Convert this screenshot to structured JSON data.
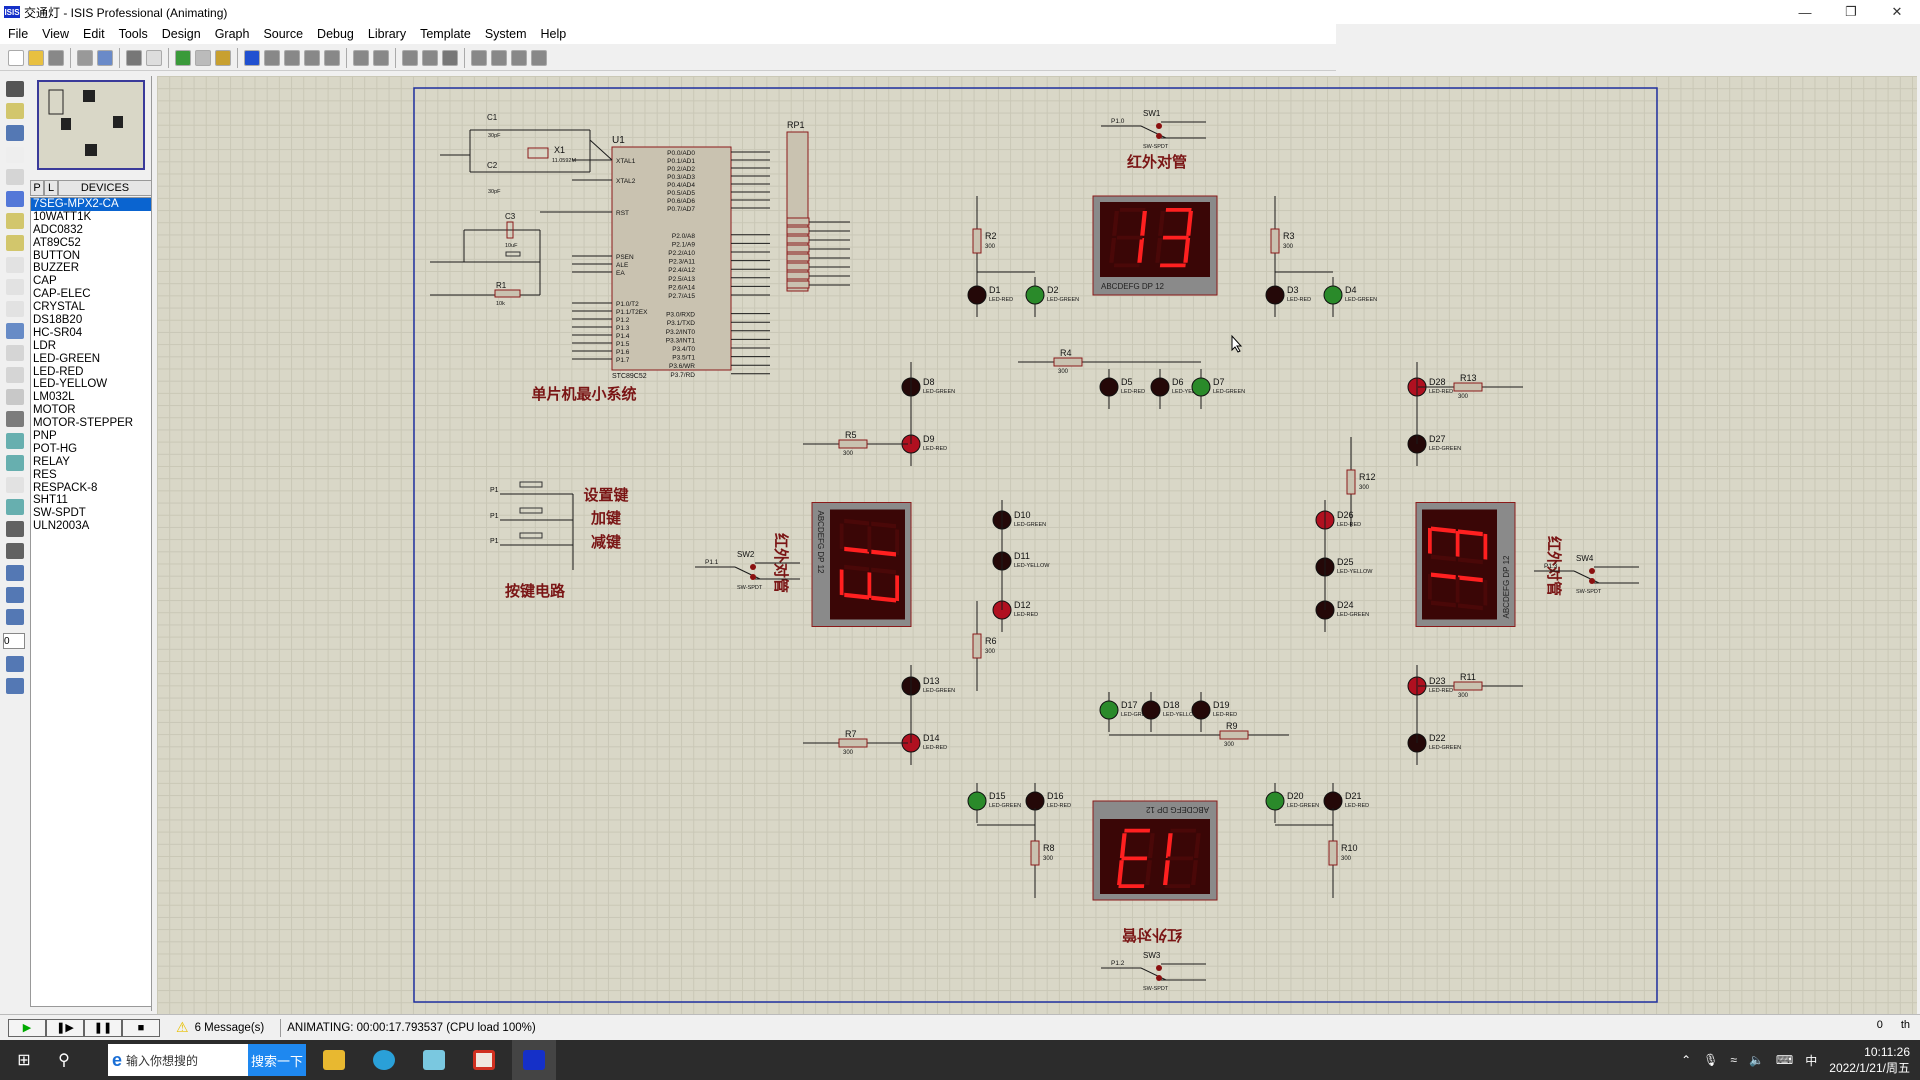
{
  "window": {
    "title": "交通灯 - ISIS Professional (Animating)",
    "app_logo": "ISIS",
    "controls": [
      "minimize",
      "restore",
      "close"
    ]
  },
  "menu": [
    "File",
    "View",
    "Edit",
    "Tools",
    "Design",
    "Graph",
    "Source",
    "Debug",
    "Library",
    "Template",
    "System",
    "Help"
  ],
  "toolbar": [
    "new-file-icon",
    "open-file-icon",
    "save-icon",
    "|",
    "import-icon",
    "export-icon",
    "|",
    "print-icon",
    "print-area-icon",
    "|",
    "refresh-icon",
    "grid-icon",
    "origin-icon",
    "|",
    "pan-icon",
    "zoom-in-icon",
    "zoom-out-icon",
    "zoom-all-icon",
    "zoom-area-icon",
    "|",
    "undo-icon",
    "redo-icon",
    "|",
    "cut-icon",
    "copy-icon",
    "paste-icon",
    "|",
    "block-copy-icon",
    "block-move-icon",
    "block-rotate-icon",
    "block-delete-icon"
  ],
  "left_tools": [
    "selection-icon",
    "component-icon",
    "junction-icon",
    "wire-label-icon",
    "text-script-icon",
    "bus-icon",
    "subcircuit-icon",
    "terminal-icon",
    "pin-icon",
    "graph-icon",
    "tape-icon",
    "generator-icon",
    "voltage-probe-icon",
    "current-probe-icon",
    "virtual-instrument-icon",
    "line-icon",
    "box-icon",
    "circle-icon",
    "arc-icon",
    "path-icon",
    "text-icon",
    "symbol-icon",
    "marker-icon",
    "rotate-cw-icon",
    "rotate-ccw-icon",
    "rotation-angle-input",
    "mirror-x-icon",
    "mirror-y-icon"
  ],
  "rotation_value": "0",
  "devices": {
    "tab_p": "P",
    "tab_l": "L",
    "header": "DEVICES",
    "selected": "7SEG-MPX2-CA",
    "items": [
      "7SEG-MPX2-CA",
      "10WATT1K",
      "ADC0832",
      "AT89C52",
      "BUTTON",
      "BUZZER",
      "CAP",
      "CAP-ELEC",
      "CRYSTAL",
      "DS18B20",
      "HC-SR04",
      "LDR",
      "LED-GREEN",
      "LED-RED",
      "LED-YELLOW",
      "LM032L",
      "MOTOR",
      "MOTOR-STEPPER",
      "PNP",
      "POT-HG",
      "RELAY",
      "RES",
      "RESPACK-8",
      "SHT11",
      "SW-SPDT",
      "ULN2003A"
    ]
  },
  "schematic": {
    "labels": {
      "ir_top": "红外对管",
      "mcu": "单片机最小系统",
      "key_set": "设置键",
      "key_add": "加键",
      "key_sub": "减键",
      "keys": "按键电路",
      "ir_left": "红外对管",
      "ir_right": "红外对管",
      "ir_bottom": "红外对管"
    },
    "mcu": {
      "ref": "U1",
      "part": "STC89C52",
      "left_pins": [
        "XTAL1",
        "XTAL2",
        "RST",
        "PSEN",
        "ALE",
        "EA",
        "P1.0/T2",
        "P1.1/T2EX",
        "P1.2",
        "P1.3",
        "P1.4",
        "P1.5",
        "P1.6",
        "P1.7"
      ],
      "right_pins": [
        "P0.0/AD0",
        "P0.1/AD1",
        "P0.2/AD2",
        "P0.3/AD3",
        "P0.4/AD4",
        "P0.5/AD5",
        "P0.6/AD6",
        "P0.7/AD7",
        "P2.0/A8",
        "P2.1/A9",
        "P2.2/A10",
        "P2.3/A11",
        "P2.4/A12",
        "P2.5/A13",
        "P2.6/A14",
        "P2.7/A15",
        "P3.0/RXD",
        "P3.1/TXD",
        "P3.2/INT0",
        "P3.3/INT1",
        "P3.4/T0",
        "P3.5/T1",
        "P3.6/WR",
        "P3.7/RD"
      ]
    },
    "passives": [
      {
        "ref": "C1",
        "value": "30pF"
      },
      {
        "ref": "C2",
        "value": "30pF"
      },
      {
        "ref": "C3",
        "value": "10uF"
      },
      {
        "ref": "R1",
        "value": "10k"
      },
      {
        "ref": "X1",
        "value": "11.0592M"
      },
      {
        "ref": "RP1",
        "value": ""
      }
    ],
    "displays": [
      {
        "id": "top",
        "value": "13",
        "pins": "ABCDEFG  DP    12"
      },
      {
        "id": "left",
        "value": "13",
        "pins": "ABCDEFG  DP    12"
      },
      {
        "id": "right",
        "value": "13",
        "pins": "ABCDEFG  DP    12"
      },
      {
        "id": "bottom",
        "value": "13",
        "pins": "ABCDEFG  DP    12"
      }
    ],
    "leds": [
      {
        "ref": "D1",
        "part": "LED-RED",
        "lit": false
      },
      {
        "ref": "D2",
        "part": "LED-GREEN",
        "lit": true
      },
      {
        "ref": "D3",
        "part": "LED-RED",
        "lit": false
      },
      {
        "ref": "D4",
        "part": "LED-GREEN",
        "lit": true
      },
      {
        "ref": "D5",
        "part": "LED-RED",
        "lit": false
      },
      {
        "ref": "D6",
        "part": "LED-YELLOW",
        "lit": false
      },
      {
        "ref": "D7",
        "part": "LED-GREEN",
        "lit": true
      },
      {
        "ref": "D8",
        "part": "LED-GREEN",
        "lit": false
      },
      {
        "ref": "D9",
        "part": "LED-RED",
        "lit": true
      },
      {
        "ref": "D28",
        "part": "LED-RED",
        "lit": true
      },
      {
        "ref": "D27",
        "part": "LED-GREEN",
        "lit": false
      },
      {
        "ref": "D10",
        "part": "LED-GREEN",
        "lit": false
      },
      {
        "ref": "D11",
        "part": "LED-YELLOW",
        "lit": false
      },
      {
        "ref": "D12",
        "part": "LED-RED",
        "lit": true
      },
      {
        "ref": "D26",
        "part": "LED-RED",
        "lit": true
      },
      {
        "ref": "D25",
        "part": "LED-YELLOW",
        "lit": false
      },
      {
        "ref": "D24",
        "part": "LED-GREEN",
        "lit": false
      },
      {
        "ref": "D13",
        "part": "LED-GREEN",
        "lit": false
      },
      {
        "ref": "D14",
        "part": "LED-RED",
        "lit": true
      },
      {
        "ref": "D23",
        "part": "LED-RED",
        "lit": true
      },
      {
        "ref": "D22",
        "part": "LED-GREEN",
        "lit": false
      },
      {
        "ref": "D17",
        "part": "LED-GREEN",
        "lit": true
      },
      {
        "ref": "D18",
        "part": "LED-YELLOW",
        "lit": false
      },
      {
        "ref": "D19",
        "part": "LED-RED",
        "lit": false
      },
      {
        "ref": "D15",
        "part": "LED-GREEN",
        "lit": true
      },
      {
        "ref": "D16",
        "part": "LED-RED",
        "lit": false
      },
      {
        "ref": "D20",
        "part": "LED-GREEN",
        "lit": true
      },
      {
        "ref": "D21",
        "part": "LED-RED",
        "lit": false
      }
    ],
    "resistors": [
      {
        "ref": "R2",
        "value": "300"
      },
      {
        "ref": "R3",
        "value": "300"
      },
      {
        "ref": "R4",
        "value": "300"
      },
      {
        "ref": "R5",
        "value": "300"
      },
      {
        "ref": "R13",
        "value": "300"
      },
      {
        "ref": "R12",
        "value": "300"
      },
      {
        "ref": "R6",
        "value": "300"
      },
      {
        "ref": "R7",
        "value": "300"
      },
      {
        "ref": "R11",
        "value": "300"
      },
      {
        "ref": "R9",
        "value": "300"
      },
      {
        "ref": "R8",
        "value": "300"
      },
      {
        "ref": "R10",
        "value": "300"
      }
    ],
    "switches": [
      {
        "ref": "SW1",
        "part": "SW-SPDT",
        "net": "P1.0"
      },
      {
        "ref": "SW2",
        "part": "SW-SPDT",
        "net": "P1.1"
      },
      {
        "ref": "SW4",
        "part": "SW-SPDT",
        "net": "P1.3"
      },
      {
        "ref": "SW3",
        "part": "SW-SPDT",
        "net": "P1.2"
      }
    ],
    "colors": {
      "wire": "#1a1a1a",
      "body": "#c9c2b0",
      "outline": "#8b1a1a",
      "led_red_on": "#b01020",
      "led_green_on": "#2a8a2a",
      "led_off": "#240808",
      "seg_on": "#ff2020",
      "seg_off": "#4a0808",
      "label": "#7a1515",
      "border": "#2030a0"
    }
  },
  "statusbar": {
    "controls": [
      "play-button",
      "step-button",
      "pause-button",
      "stop-button"
    ],
    "messages": "6 Message(s)",
    "animation": "ANIMATING: 00:00:17.793537 (CPU load 100%)",
    "right_a": "0",
    "right_b": "th"
  },
  "taskbar": {
    "search_placeholder": "输入你想搜的",
    "search_button": "搜索一下",
    "apps": [
      "file-explorer-icon",
      "browser-icon",
      "game-icon",
      "media-icon",
      "isis-icon"
    ],
    "ime": "中",
    "time": "10:11:26",
    "date": "2022/1/21/周五"
  }
}
